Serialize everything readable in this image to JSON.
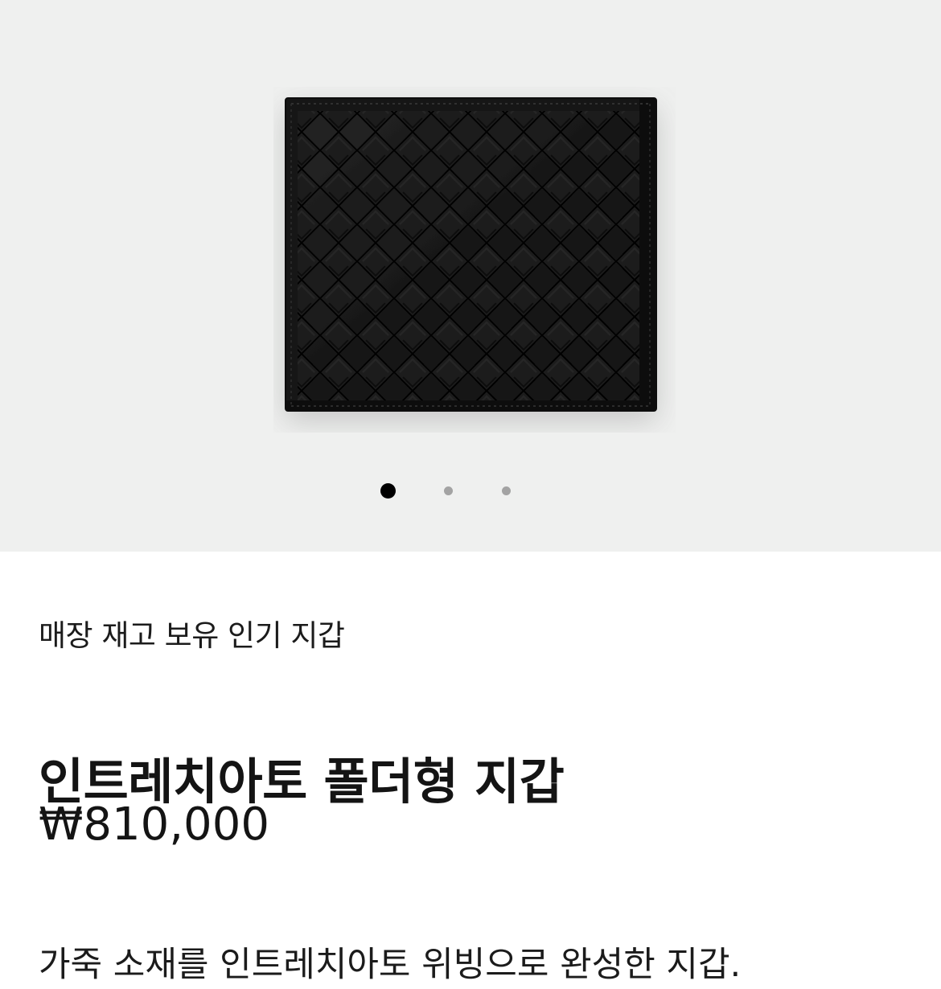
{
  "gallery": {
    "image_alt": "인트레치아토 폴더형 지갑",
    "dots": {
      "count": 3,
      "active_index": 0
    }
  },
  "product": {
    "tag": "매장 재고 보유 인기 지갑",
    "title": "인트레치아토 폴더형 지갑",
    "price": "₩810,000",
    "description": "가죽 소재를 인트레치아토 위빙으로 완성한 지갑."
  },
  "colors": {
    "gallery_background": "#eff0ef",
    "page_background": "#ffffff",
    "text": "#141414",
    "dot_active": "#000000",
    "dot_inactive": "#a3a3a3",
    "wallet": "#1c1c1c"
  }
}
